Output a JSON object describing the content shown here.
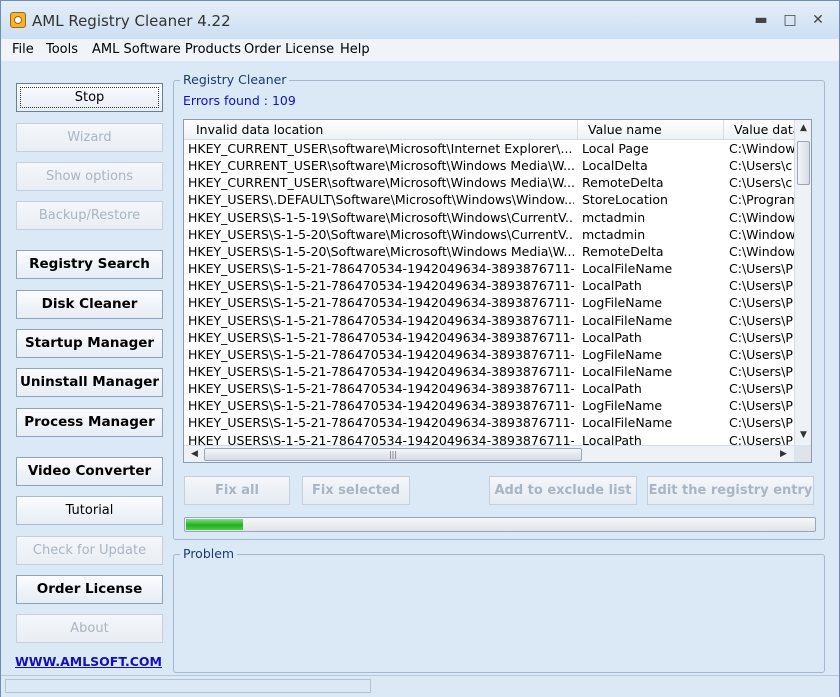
{
  "window": {
    "title": "AML Registry Cleaner 4.22",
    "minimize": "▬",
    "maximize": "□",
    "close": "✕"
  },
  "menu": [
    "File",
    "Tools",
    "AML Software Products",
    "Order License",
    "Help"
  ],
  "sidebar": {
    "buttons": [
      {
        "label": "Stop",
        "enabled": true,
        "bold": false,
        "focused": true
      },
      {
        "label": "Wizard",
        "enabled": false,
        "bold": false
      },
      {
        "label": "Show options",
        "enabled": false,
        "bold": false
      },
      {
        "label": "Backup/Restore",
        "enabled": false,
        "bold": false
      },
      {
        "label": "Registry Search",
        "enabled": true,
        "bold": true
      },
      {
        "label": "Disk Cleaner",
        "enabled": true,
        "bold": true
      },
      {
        "label": "Startup Manager",
        "enabled": true,
        "bold": true
      },
      {
        "label": "Uninstall Manager",
        "enabled": true,
        "bold": true
      },
      {
        "label": "Process Manager",
        "enabled": true,
        "bold": true
      },
      {
        "label": "Video Converter",
        "enabled": true,
        "bold": true
      },
      {
        "label": "Tutorial",
        "enabled": true,
        "bold": false
      },
      {
        "label": "Check for Update",
        "enabled": false,
        "bold": false
      },
      {
        "label": "Order License",
        "enabled": true,
        "bold": true
      },
      {
        "label": "About",
        "enabled": false,
        "bold": false
      }
    ],
    "link": "WWW.AMLSOFT.COM"
  },
  "registry_cleaner": {
    "group_title": "Registry Cleaner",
    "errors_found": "Errors found : 109",
    "columns": [
      "Invalid data location",
      "Value name",
      "Value data"
    ],
    "rows": [
      [
        "HKEY_CURRENT_USER\\software\\Microsoft\\Internet Explorer\\...",
        "Local Page",
        "C:\\Windows"
      ],
      [
        "HKEY_CURRENT_USER\\software\\Microsoft\\Windows Media\\W...",
        "LocalDelta",
        "C:\\Users\\c"
      ],
      [
        "HKEY_CURRENT_USER\\software\\Microsoft\\Windows Media\\W...",
        "RemoteDelta",
        "C:\\Users\\c"
      ],
      [
        "HKEY_USERS\\.DEFAULT\\Software\\Microsoft\\Windows\\Window...",
        "StoreLocation",
        "C:\\Program"
      ],
      [
        "HKEY_USERS\\S-1-5-19\\Software\\Microsoft\\Windows\\CurrentV...",
        "mctadmin",
        "C:\\Windows"
      ],
      [
        "HKEY_USERS\\S-1-5-20\\Software\\Microsoft\\Windows\\CurrentV...",
        "mctadmin",
        "C:\\Windows"
      ],
      [
        "HKEY_USERS\\S-1-5-20\\Software\\Microsoft\\Windows Media\\W...",
        "RemoteDelta",
        "C:\\Windows"
      ],
      [
        "HKEY_USERS\\S-1-5-21-786470534-1942049634-3893876711-...",
        "LocalFileName",
        "C:\\Users\\P"
      ],
      [
        "HKEY_USERS\\S-1-5-21-786470534-1942049634-3893876711-...",
        "LocalPath",
        "C:\\Users\\P"
      ],
      [
        "HKEY_USERS\\S-1-5-21-786470534-1942049634-3893876711-...",
        "LogFileName",
        "C:\\Users\\P"
      ],
      [
        "HKEY_USERS\\S-1-5-21-786470534-1942049634-3893876711-...",
        "LocalFileName",
        "C:\\Users\\P"
      ],
      [
        "HKEY_USERS\\S-1-5-21-786470534-1942049634-3893876711-...",
        "LocalPath",
        "C:\\Users\\P"
      ],
      [
        "HKEY_USERS\\S-1-5-21-786470534-1942049634-3893876711-...",
        "LogFileName",
        "C:\\Users\\P"
      ],
      [
        "HKEY_USERS\\S-1-5-21-786470534-1942049634-3893876711-...",
        "LocalFileName",
        "C:\\Users\\P"
      ],
      [
        "HKEY_USERS\\S-1-5-21-786470534-1942049634-3893876711-...",
        "LocalPath",
        "C:\\Users\\P"
      ],
      [
        "HKEY_USERS\\S-1-5-21-786470534-1942049634-3893876711-...",
        "LogFileName",
        "C:\\Users\\P"
      ],
      [
        "HKEY_USERS\\S-1-5-21-786470534-1942049634-3893876711-...",
        "LocalFileName",
        "C:\\Users\\P"
      ],
      [
        "HKEY_USERS\\S-1-5-21-786470534-1942049634-3893876711-...",
        "LocalPath",
        "C:\\Users\\P"
      ]
    ],
    "actions": [
      "Fix all",
      "Fix selected",
      "Add to exclude list",
      "Edit the registry entry"
    ],
    "progress_fraction": 0.09
  },
  "problem": {
    "group_title": "Problem"
  },
  "colors": {
    "link": "#1010c0",
    "errors_text": "#1010c8",
    "progress": "#22b022"
  }
}
